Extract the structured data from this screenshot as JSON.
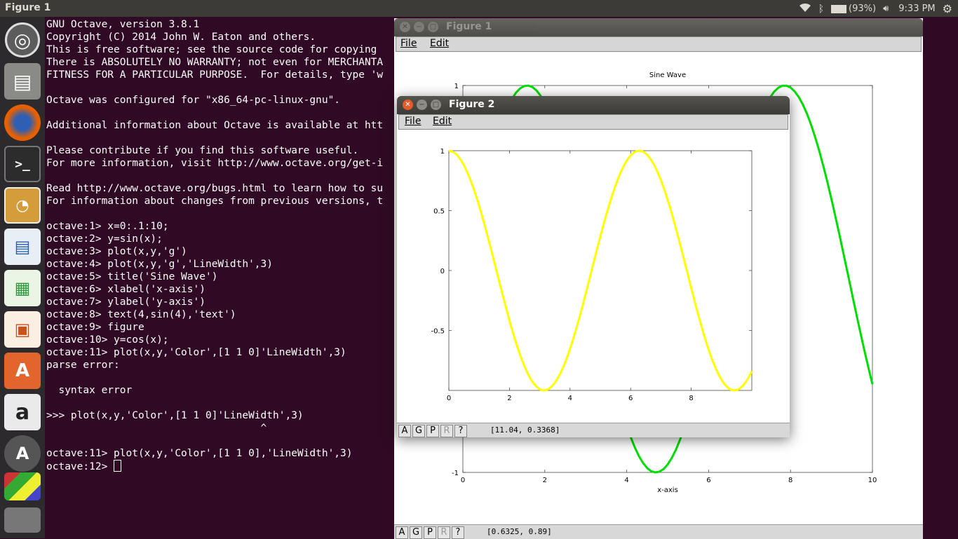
{
  "topbar": {
    "title": "Figure 1",
    "battery": "(93%)",
    "time": "9:33 PM"
  },
  "launcher": {
    "items": [
      "ubuntu-dash",
      "files",
      "firefox",
      "terminal",
      "octave",
      "libreoffice-writer",
      "libreoffice-calc",
      "libreoffice-impress",
      "software-center",
      "amazon",
      "updater",
      "workspaces"
    ]
  },
  "terminal": {
    "lines": [
      "GNU Octave, version 3.8.1",
      "Copyright (C) 2014 John W. Eaton and others.",
      "This is free software; see the source code for copying",
      "There is ABSOLUTELY NO WARRANTY; not even for MERCHANTA",
      "FITNESS FOR A PARTICULAR PURPOSE.  For details, type 'w",
      "",
      "Octave was configured for \"x86_64-pc-linux-gnu\".",
      "",
      "Additional information about Octave is available at htt",
      "",
      "Please contribute if you find this software useful.",
      "For more information, visit http://www.octave.org/get-i",
      "",
      "Read http://www.octave.org/bugs.html to learn how to su",
      "For information about changes from previous versions, t",
      "",
      "octave:1> x=0:.1:10;",
      "octave:2> y=sin(x);",
      "octave:3> plot(x,y,'g')",
      "octave:4> plot(x,y,'g','LineWidth',3)",
      "octave:5> title('Sine Wave')",
      "octave:6> xlabel('x-axis')",
      "octave:7> ylabel('y-axis')",
      "octave:8> text(4,sin(4),'text')",
      "octave:9> figure",
      "octave:10> y=cos(x);",
      "octave:11> plot(x,y,'Color',[1 1 0]'LineWidth',3)",
      "parse error:",
      "",
      "  syntax error",
      "",
      ">>> plot(x,y,'Color',[1 1 0]'LineWidth',3)",
      "                                   ^",
      "",
      "octave:11> plot(x,y,'Color',[1 1 0],'LineWidth',3)"
    ],
    "prompt": "octave:12> "
  },
  "figure1": {
    "window_title": "Figure 1",
    "menu_file": "File",
    "menu_edit": "Edit",
    "toolbar": [
      "A",
      "G",
      "P",
      "R",
      "?"
    ],
    "coordinates": "[0.6325, 0.89]",
    "chart_data": {
      "type": "line",
      "title": "Sine Wave",
      "xlabel": "x-axis",
      "ylabel": "",
      "xlim": [
        0,
        10
      ],
      "ylim": [
        -1,
        1
      ],
      "x_ticks": [
        "0",
        "2",
        "4",
        "6",
        "8",
        "10"
      ],
      "y_ticks": [
        "1",
        "-1"
      ],
      "function": "sin",
      "x_range": [
        0,
        10
      ],
      "step": 0.1,
      "line_color": "#00dd00",
      "grid": false
    }
  },
  "figure2": {
    "window_title": "Figure 2",
    "menu_file": "File",
    "menu_edit": "Edit",
    "toolbar": [
      "A",
      "G",
      "P",
      "R",
      "?"
    ],
    "coordinates": "[11.04, 0.3368]",
    "chart_data": {
      "type": "line",
      "title": "",
      "xlabel": "",
      "ylabel": "",
      "xlim": [
        0,
        10
      ],
      "ylim": [
        -1,
        1
      ],
      "x_ticks": [
        "0",
        "2",
        "4",
        "6",
        "8"
      ],
      "y_ticks": [
        "1",
        "0.5",
        "0",
        "-0.5"
      ],
      "function": "cos",
      "x_range": [
        0,
        10
      ],
      "step": 0.1,
      "line_color": "#ffff00",
      "grid": false
    }
  }
}
